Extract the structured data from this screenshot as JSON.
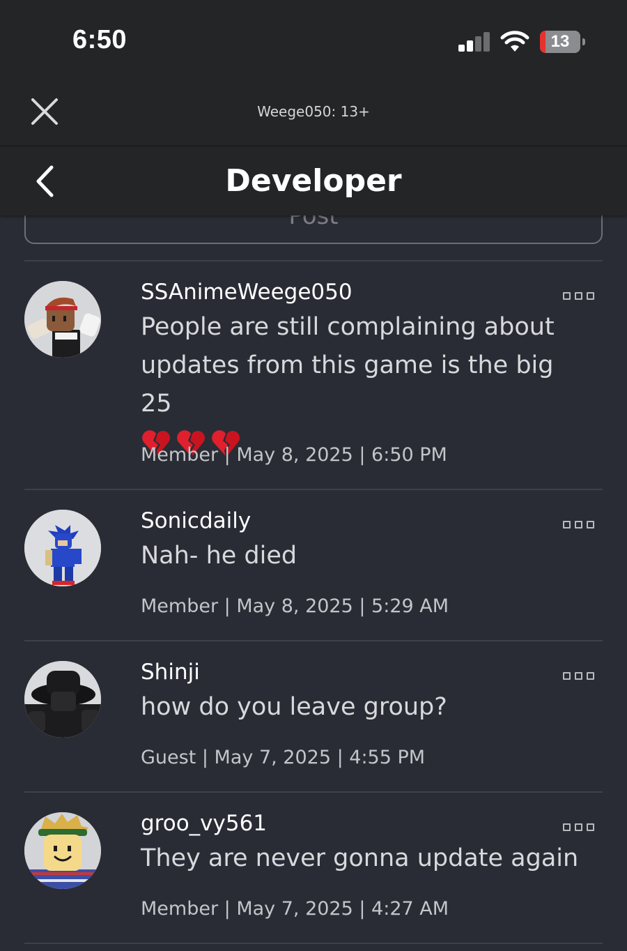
{
  "status_bar": {
    "time": "6:50",
    "battery_level": "13",
    "battery_color": "#e5322d"
  },
  "webview": {
    "title": "Weege050: 13+",
    "close_icon": "close-icon"
  },
  "nav": {
    "title": "Developer",
    "back_icon": "chevron-left-icon"
  },
  "post_button": {
    "label": "Post"
  },
  "comments": [
    {
      "username": "SSAnimeWeege050",
      "text": "People are still complaining about updates from this game is the big 25",
      "emoji": [
        "broken-heart-icon",
        "broken-heart-icon",
        "broken-heart-icon"
      ],
      "meta": "Member | May 8, 2025 | 6:50 PM"
    },
    {
      "username": "Sonicdaily",
      "text": "Nah- he died",
      "meta": "Member | May 8, 2025 | 5:29 AM"
    },
    {
      "username": "Shinji",
      "text": "how do you leave group?",
      "meta": "Guest | May 7, 2025 | 4:55 PM"
    },
    {
      "username": "groo_vy561",
      "text": "They are never gonna update again",
      "meta": "Member | May 7, 2025 | 4:27 AM"
    }
  ]
}
